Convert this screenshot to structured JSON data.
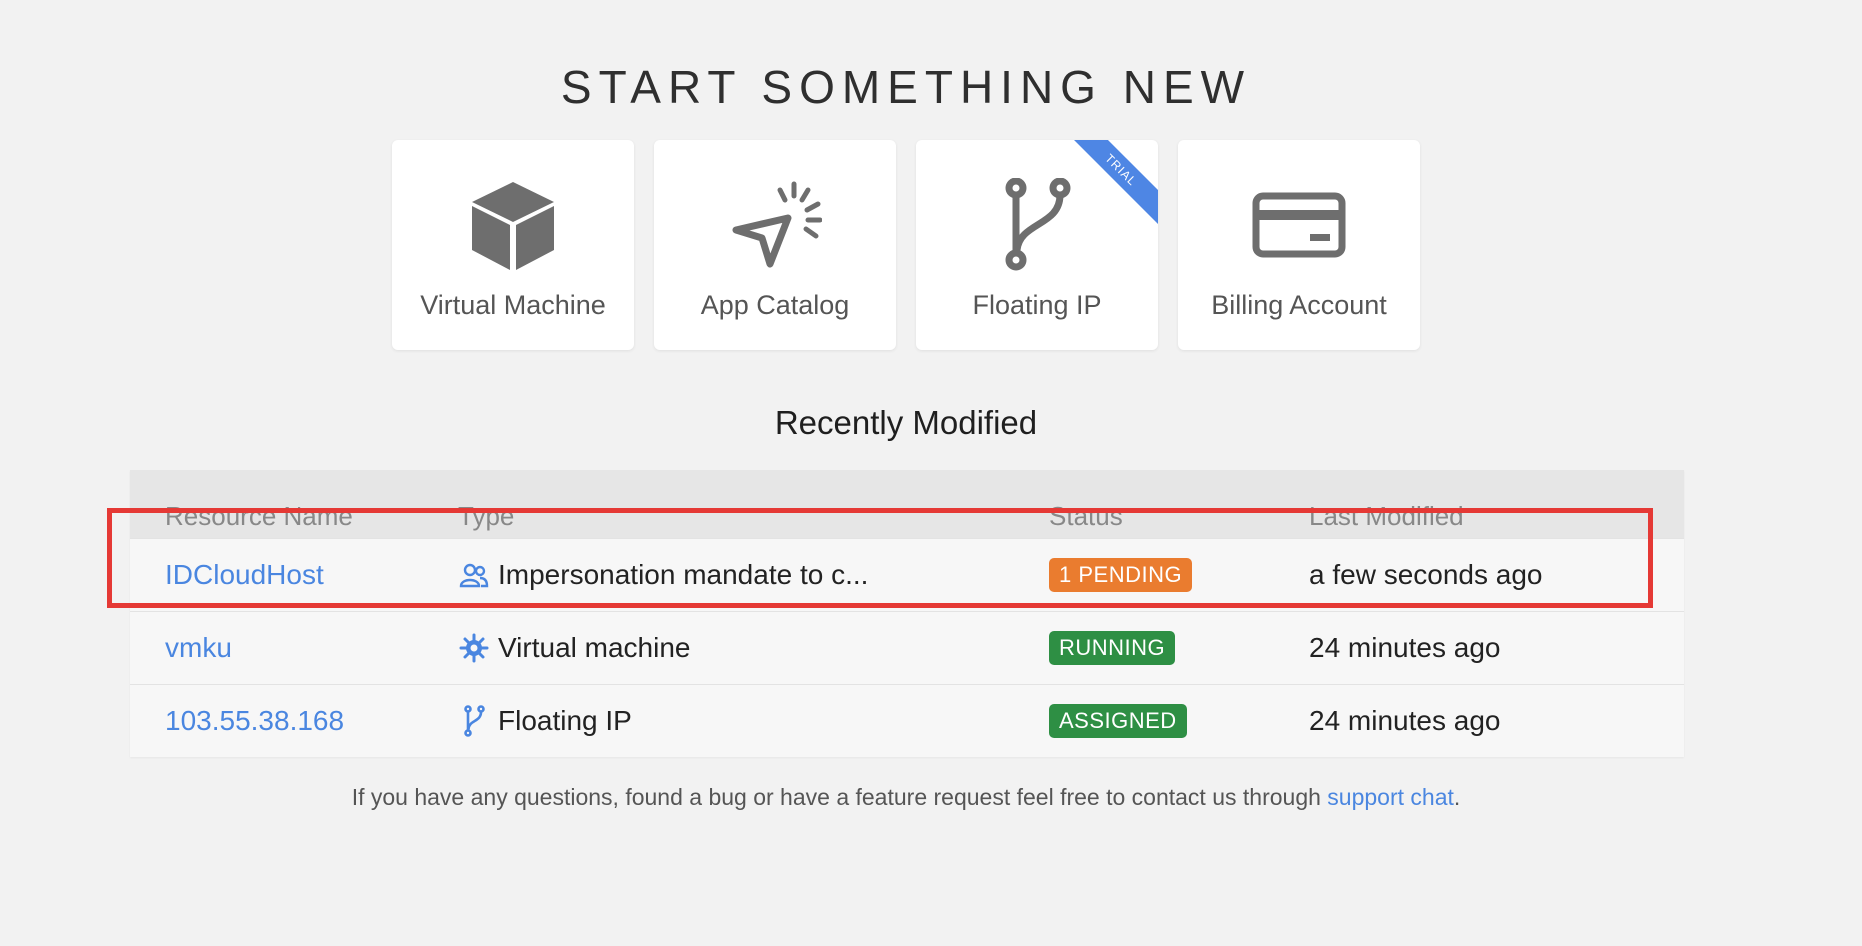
{
  "hero": {
    "title": "START SOMETHING NEW"
  },
  "cards": [
    {
      "label": "Virtual Machine",
      "icon": "cube-icon"
    },
    {
      "label": "App Catalog",
      "icon": "cursor-sparkle-icon"
    },
    {
      "label": "Floating IP",
      "icon": "fork-icon",
      "ribbon": "TRIAL"
    },
    {
      "label": "Billing Account",
      "icon": "credit-card-icon"
    }
  ],
  "recent": {
    "title": "Recently Modified",
    "columns": [
      "Resource Name",
      "Type",
      "Status",
      "Last Modified"
    ],
    "rows": [
      {
        "name": "IDCloudHost",
        "type_icon": "users-icon",
        "type": "Impersonation mandate to c...",
        "status": "1 PENDING",
        "status_color": "#ea7c2f",
        "modified": "a few seconds ago"
      },
      {
        "name": "vmku",
        "type_icon": "gear-icon",
        "type": "Virtual machine",
        "status": "RUNNING",
        "status_color": "#2e8f44",
        "modified": "24 minutes ago"
      },
      {
        "name": "103.55.38.168",
        "type_icon": "fork-icon",
        "type": "Floating IP",
        "status": "ASSIGNED",
        "status_color": "#2e8f44",
        "modified": "24 minutes ago"
      }
    ]
  },
  "footer": {
    "text": "If you have any questions, found a bug or have a feature request feel free to contact us through ",
    "link": "support chat",
    "end": "."
  },
  "colors": {
    "accent": "#4a86e0",
    "highlight": "#e53935",
    "ribbon": "#4e86e4"
  }
}
